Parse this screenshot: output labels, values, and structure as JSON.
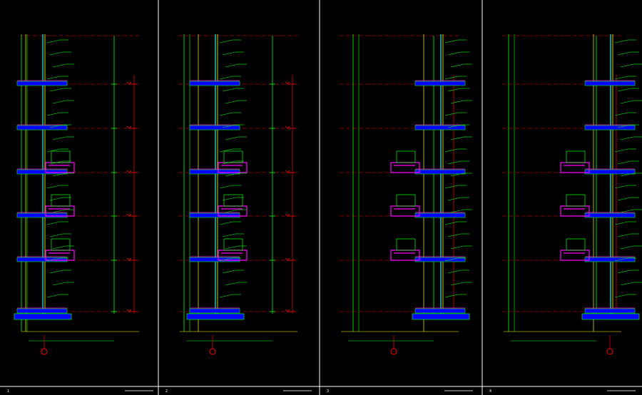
{
  "sheets": [
    {
      "name": "wall-section-sheet-1",
      "title_block": "1"
    },
    {
      "name": "wall-section-sheet-2",
      "title_block": "2"
    },
    {
      "name": "wall-section-sheet-3",
      "title_block": "3"
    },
    {
      "name": "wall-section-sheet-4",
      "title_block": "4"
    }
  ],
  "colors": {
    "background": "#000000",
    "frame": "#ffffff",
    "structure": "#00ff00",
    "facade": "#ffff00",
    "glass": "#00ffff",
    "detail": "#ff00ff",
    "axis": "#ff0000",
    "fill": "#0000ff"
  },
  "grid_marker_glyph": "⊕"
}
